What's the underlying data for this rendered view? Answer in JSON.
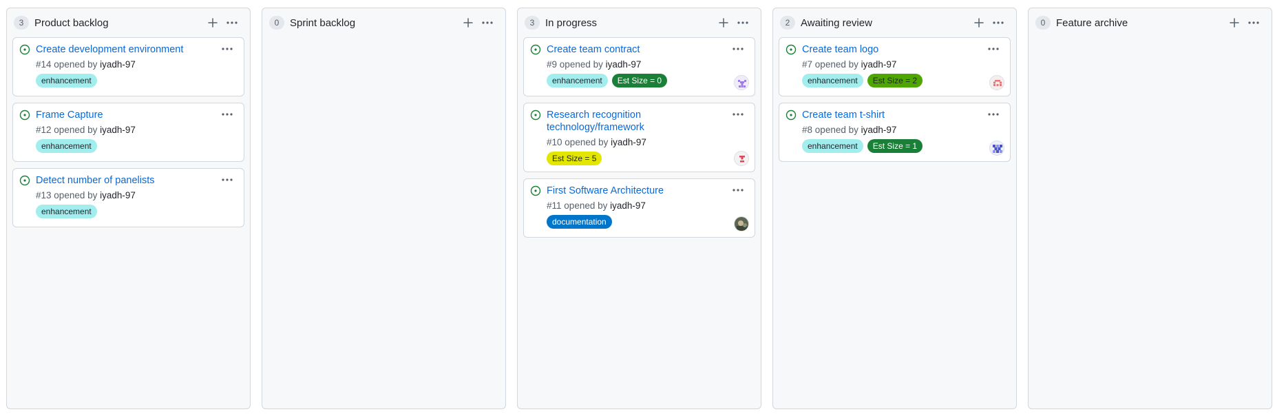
{
  "colors": {
    "enhancement_bg": "#a2eeef",
    "enhancement_fg": "#1f2328",
    "documentation_bg": "#0075ca",
    "documentation_fg": "#ffffff",
    "est0_bg": "#1a7f37",
    "est1_bg": "#1a7f37",
    "est2_bg": "#4ea600",
    "est2_fg": "#1f2328",
    "est5_bg": "#e2e600",
    "est5_fg": "#1f2328",
    "open_issue": "#1a7f37"
  },
  "icons": {
    "add": "plus-icon",
    "menu": "kebab-horizontal-icon",
    "issue": "issue-opened-icon"
  },
  "columns": [
    {
      "title": "Product backlog",
      "count": "3",
      "cards": [
        {
          "title": "Create development environment",
          "number": "#14",
          "opened_by": "opened by",
          "author": "iyadh-97",
          "labels": [
            "enhancement"
          ]
        },
        {
          "title": "Frame Capture",
          "number": "#12",
          "opened_by": "opened by",
          "author": "iyadh-97",
          "labels": [
            "enhancement"
          ]
        },
        {
          "title": "Detect number of panelists",
          "number": "#13",
          "opened_by": "opened by",
          "author": "iyadh-97",
          "labels": [
            "enhancement"
          ]
        }
      ]
    },
    {
      "title": "Sprint backlog",
      "count": "0",
      "cards": []
    },
    {
      "title": "In progress",
      "count": "3",
      "cards": [
        {
          "title": "Create team contract",
          "number": "#9",
          "opened_by": "opened by",
          "author": "iyadh-97",
          "labels": [
            "enhancement",
            "Est Size = 0"
          ],
          "avatar": "avatar-1"
        },
        {
          "title": "Research recognition technology/framework",
          "number": "#10",
          "opened_by": "opened by",
          "author": "iyadh-97",
          "labels": [
            "Est Size = 5"
          ],
          "avatar": "avatar-2"
        },
        {
          "title": "First Software Architecture",
          "number": "#11",
          "opened_by": "opened by",
          "author": "iyadh-97",
          "labels": [
            "documentation"
          ],
          "avatar": "avatar-3"
        }
      ]
    },
    {
      "title": "Awaiting review",
      "count": "2",
      "cards": [
        {
          "title": "Create team logo",
          "number": "#7",
          "opened_by": "opened by",
          "author": "iyadh-97",
          "labels": [
            "enhancement",
            "Est Size = 2"
          ],
          "avatar": "avatar-4"
        },
        {
          "title": "Create team t-shirt",
          "number": "#8",
          "opened_by": "opened by",
          "author": "iyadh-97",
          "labels": [
            "enhancement",
            "Est Size = 1"
          ],
          "avatar": "avatar-5"
        }
      ]
    },
    {
      "title": "Feature archive",
      "count": "0",
      "cards": []
    }
  ]
}
